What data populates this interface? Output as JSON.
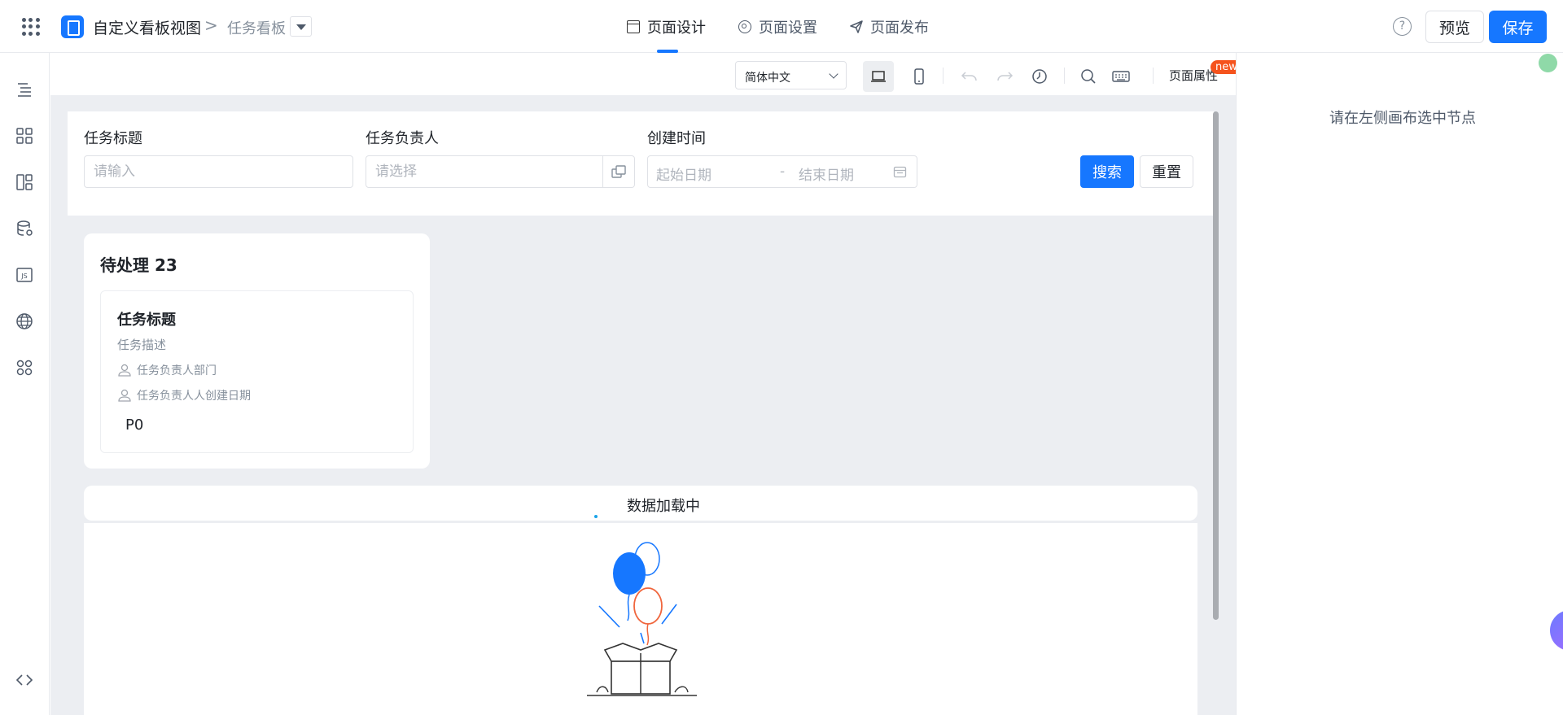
{
  "header": {
    "app_name": "自定义看板视图",
    "crumb_separator": ">",
    "page_name": "任务看板",
    "tabs": [
      {
        "label": "页面设计",
        "icon": "layout-icon",
        "active": true
      },
      {
        "label": "页面设置",
        "icon": "gear-icon",
        "active": false
      },
      {
        "label": "页面发布",
        "icon": "send-icon",
        "active": false
      }
    ],
    "help_symbol": "?",
    "preview_label": "预览",
    "save_label": "保存"
  },
  "sidebar": {
    "icons": [
      "outline-tree-icon",
      "components-grid-icon",
      "layout-template-icon",
      "data-source-icon",
      "js-code-icon",
      "globe-icon",
      "apps-icon",
      "code-brackets-icon"
    ],
    "code_toggle_label": "</>"
  },
  "toolbar": {
    "language": "简体中文",
    "page_props_label": "页面属性",
    "new_badge": "new"
  },
  "filters": {
    "title_label": "任务标题",
    "title_placeholder": "请输入",
    "owner_label": "任务负责人",
    "owner_placeholder": "请选择",
    "created_label": "创建时间",
    "start_placeholder": "起始日期",
    "range_separator": "-",
    "end_placeholder": "结束日期",
    "search_label": "搜索",
    "reset_label": "重置"
  },
  "kanban": {
    "column_title": "待处理 23",
    "card": {
      "title": "任务标题",
      "description": "任务描述",
      "department": "任务负责人部门",
      "created": "任务负责人人创建日期",
      "priority": "P0"
    }
  },
  "loading": {
    "text": "数据加载中"
  },
  "right_panel": {
    "hint": "请在左侧画布选中节点"
  },
  "colors": {
    "accent": "#1677ff",
    "badge": "#f5531d",
    "canvas_bg": "#eceef2"
  }
}
